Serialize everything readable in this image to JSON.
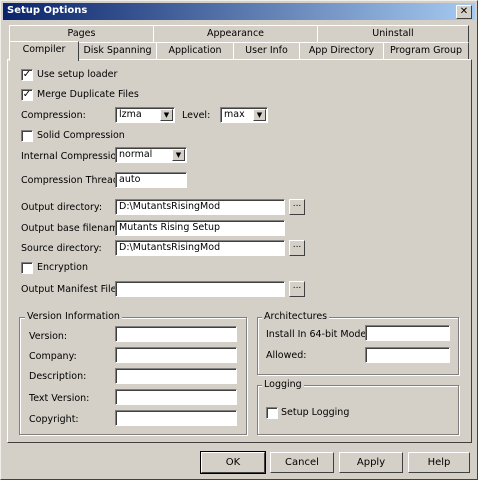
{
  "window": {
    "title": "Setup Options",
    "close_glyph": "✕"
  },
  "tabs_row1": [
    "Pages",
    "Appearance",
    "Uninstall"
  ],
  "tabs_row2": [
    "Compiler",
    "Disk Spanning",
    "Application",
    "User Info",
    "App Directory",
    "Program Group"
  ],
  "active_tab": "Compiler",
  "compiler": {
    "use_setup_loader": {
      "label": "Use setup loader",
      "checked": true
    },
    "merge_duplicate_files": {
      "label": "Merge Duplicate Files",
      "checked": true
    },
    "compression": {
      "label": "Compression:",
      "value": "lzma"
    },
    "level": {
      "label": "Level:",
      "value": "max"
    },
    "solid_compression": {
      "label": "Solid Compression",
      "checked": false
    },
    "internal_compression": {
      "label": "Internal Compression:",
      "value": "normal"
    },
    "compression_threads": {
      "label": "Compression Threads:",
      "value": "auto"
    },
    "output_directory": {
      "label": "Output directory:",
      "value": "D:\\MutantsRisingMod"
    },
    "output_base_filename": {
      "label": "Output base filename:",
      "value": "Mutants Rising Setup"
    },
    "source_directory": {
      "label": "Source directory:",
      "value": "D:\\MutantsRisingMod"
    },
    "encryption": {
      "label": "Encryption",
      "checked": false
    },
    "output_manifest_file": {
      "label": "Output Manifest File:",
      "value": ""
    },
    "browse_label": "..."
  },
  "version_information": {
    "title": "Version Information",
    "version": {
      "label": "Version:",
      "value": ""
    },
    "company": {
      "label": "Company:",
      "value": ""
    },
    "description": {
      "label": "Description:",
      "value": ""
    },
    "text_version": {
      "label": "Text Version:",
      "value": ""
    },
    "copyright": {
      "label": "Copyright:",
      "value": ""
    }
  },
  "architectures": {
    "title": "Architectures",
    "install_64": {
      "label": "Install In 64-bit Mode:",
      "value": ""
    },
    "allowed": {
      "label": "Allowed:",
      "value": ""
    }
  },
  "logging": {
    "title": "Logging",
    "setup_logging": {
      "label": "Setup Logging",
      "checked": false
    }
  },
  "buttons": {
    "ok": "OK",
    "cancel": "Cancel",
    "apply": "Apply",
    "help": "Help"
  },
  "check_glyph": "✓",
  "dropdown_glyph": "▼"
}
